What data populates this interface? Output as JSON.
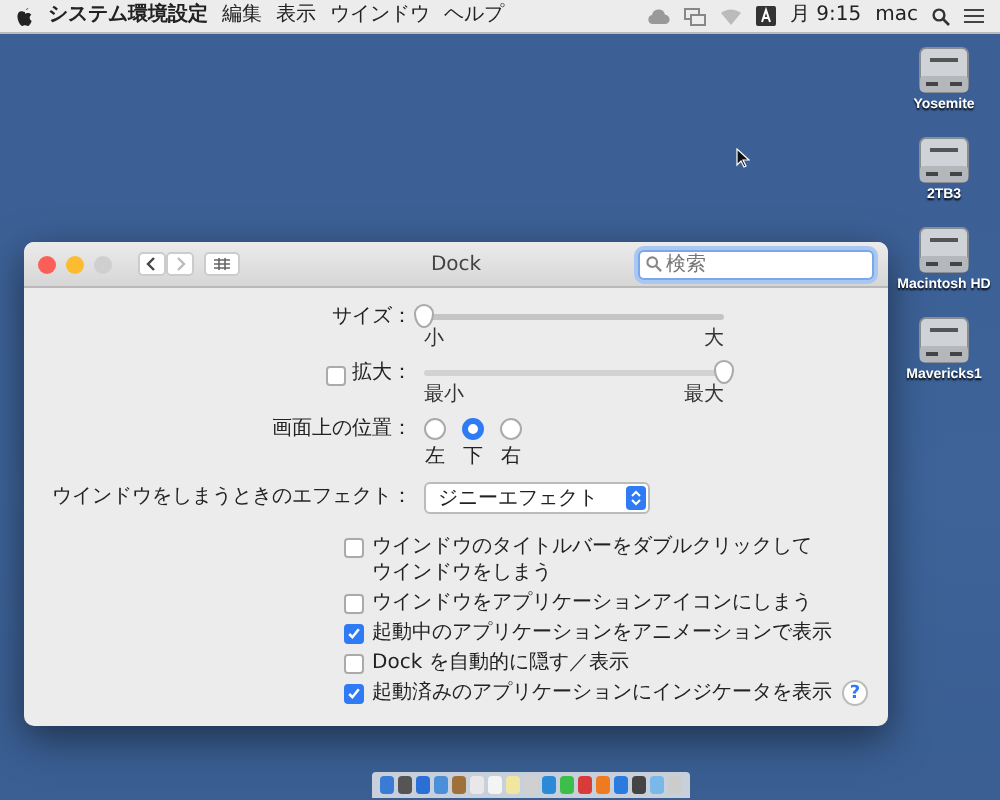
{
  "menubar": {
    "app_name": "システム環境設定",
    "menus": [
      "編集",
      "表示",
      "ウインドウ",
      "ヘルプ"
    ],
    "clock": "月 9:15",
    "user": "mac"
  },
  "desktop_icons": [
    {
      "label": "Yosemite"
    },
    {
      "label": "2TB3"
    },
    {
      "label": "Macintosh HD"
    },
    {
      "label": "Mavericks1"
    }
  ],
  "window": {
    "title": "Dock",
    "search": {
      "placeholder": "検索"
    },
    "size": {
      "label": "サイズ：",
      "level": 0,
      "min_label": "小",
      "max_label": "大"
    },
    "magnification": {
      "label": "拡大：",
      "checked": false,
      "level": 1,
      "min_label": "最小",
      "max_label": "最大"
    },
    "position": {
      "label": "画面上の位置：",
      "options": [
        {
          "label": "左",
          "selected": false
        },
        {
          "label": "下",
          "selected": true
        },
        {
          "label": "右",
          "selected": false
        }
      ]
    },
    "effect": {
      "label": "ウインドウをしまうときのエフェクト：",
      "value": "ジニーエフェクト"
    },
    "options": [
      {
        "lines": [
          "ウインドウのタイトルバーをダブルクリックして",
          "ウインドウをしまう"
        ],
        "checked": false
      },
      {
        "lines": [
          "ウインドウをアプリケーションアイコンにしまう"
        ],
        "checked": false
      },
      {
        "lines": [
          "起動中のアプリケーションをアニメーションで表示"
        ],
        "checked": true
      },
      {
        "lines": [
          "Dock を自動的に隠す／表示"
        ],
        "checked": false
      },
      {
        "lines": [
          "起動済みのアプリケーションにインジケータを表示"
        ],
        "checked": true
      }
    ],
    "help": "?"
  }
}
